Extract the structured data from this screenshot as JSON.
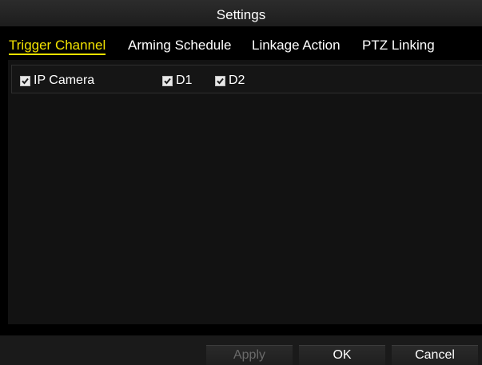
{
  "window": {
    "title": "Settings"
  },
  "tabs": [
    {
      "label": "Trigger Channel",
      "active": true
    },
    {
      "label": "Arming Schedule",
      "active": false
    },
    {
      "label": "Linkage Action",
      "active": false
    },
    {
      "label": "PTZ Linking",
      "active": false
    }
  ],
  "trigger_channel": {
    "group": {
      "label": "IP Camera",
      "checked": true
    },
    "channels": [
      {
        "label": "D1",
        "checked": true
      },
      {
        "label": "D2",
        "checked": true
      }
    ]
  },
  "footer": {
    "apply_label": "Apply",
    "apply_enabled": false,
    "ok_label": "OK",
    "cancel_label": "Cancel"
  },
  "colors": {
    "active_tab": "#f2e200",
    "background": "#000000",
    "disabled_text": "#6a6a6a"
  },
  "icons": {
    "checkbox": "checkbox-checked-icon"
  }
}
